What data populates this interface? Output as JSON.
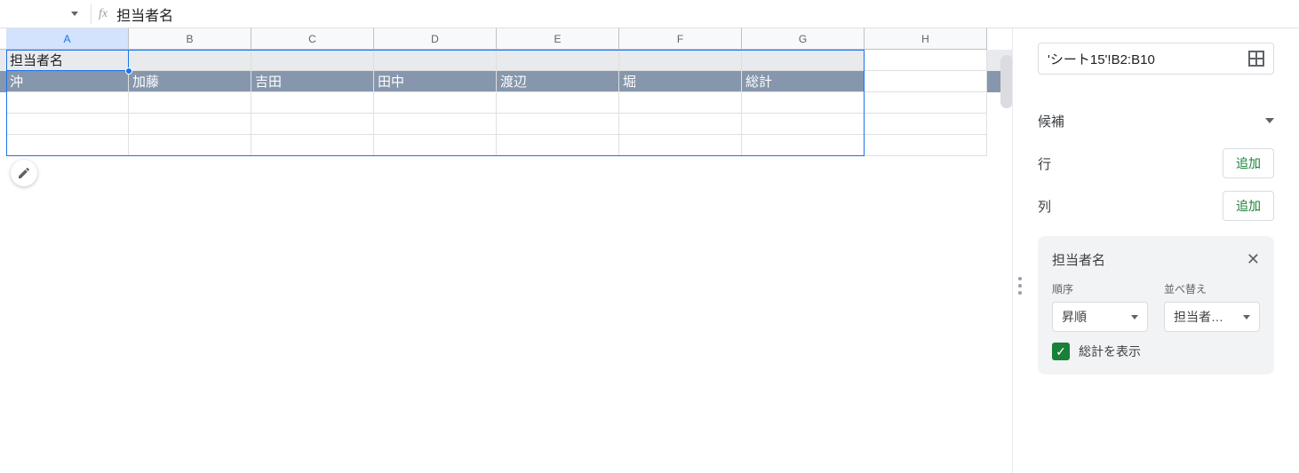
{
  "formula_bar": {
    "fx_label": "fx",
    "value": "担当者名"
  },
  "columns": [
    "A",
    "B",
    "C",
    "D",
    "E",
    "F",
    "G",
    "H"
  ],
  "grid": {
    "row1": {
      "a": "担当者名"
    },
    "row2": [
      "沖",
      "加藤",
      "吉田",
      "田中",
      "渡辺",
      "堀",
      "総計"
    ]
  },
  "panel": {
    "range": "'シート15'!B2:B10",
    "candidates_label": "候補",
    "rows_label": "行",
    "cols_label": "列",
    "add_label": "追加",
    "card": {
      "title": "担当者名",
      "order_label": "順序",
      "sort_label": "並べ替え",
      "order_value": "昇順",
      "sort_value": "担当者…",
      "show_totals": "総計を表示"
    }
  }
}
